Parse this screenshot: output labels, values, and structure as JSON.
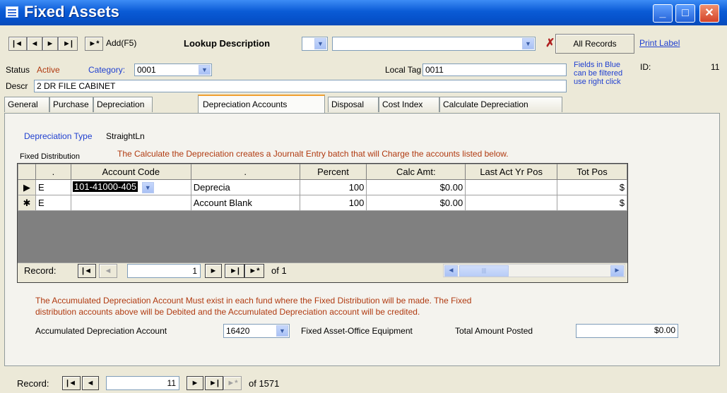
{
  "window": {
    "title": "Fixed Assets",
    "minimize": "_",
    "maximize": "□",
    "close": "✕"
  },
  "toolbar": {
    "first": "|◄",
    "prev": "◄",
    "next": "►",
    "last": "►|",
    "new_rec": "►*",
    "add_label": "Add(F5)",
    "lookup_label": "Lookup Description",
    "lookup_value": "",
    "clear_filter": "✗",
    "all_records": "All Records",
    "print_label": "Print Label"
  },
  "header": {
    "status_label": "Status",
    "status_value": "Active",
    "category_label": "Category:",
    "category_value": "0001",
    "local_tag_label": "Local Tag",
    "local_tag_value": "0011",
    "note": [
      "Fields in Blue",
      "can be filtered",
      "use right click"
    ],
    "id_label": "ID:",
    "id_value": "11",
    "descr_label": "Descr",
    "descr_value": "2 DR FILE CABINET"
  },
  "tabs": [
    "General",
    "Purchase",
    "Depreciation",
    "Depreciation Accounts",
    "Disposal",
    "Cost Index",
    "Calculate Depreciation"
  ],
  "content": {
    "dep_type_label": "Depreciation Type",
    "dep_type_value": "StraightLn",
    "fixed_dist_label": "Fixed Distribution",
    "calc_note": "The Calculate the Depreciation creates a Journalt Entry batch that will Charge the accounts listed below."
  },
  "grid": {
    "columns": [
      ".",
      "Account Code",
      ".",
      "Percent",
      "Calc Amt:",
      "Last Act Yr Pos",
      "Tot Pos"
    ],
    "rows": [
      {
        "marker": "▶",
        "type": "E",
        "account_code": "101-41000-405",
        "desc": "Deprecia",
        "percent": "100",
        "calc_amt": "$0.00",
        "last_yr": "",
        "tot": "$"
      },
      {
        "marker": "✱",
        "type": "E",
        "account_code": "",
        "desc": "Account Blank",
        "percent": "100",
        "calc_amt": "$0.00",
        "last_yr": "",
        "tot": "$"
      }
    ],
    "nav": {
      "label": "Record:",
      "current": "1",
      "of": "of 1"
    }
  },
  "accum": {
    "note_line1": "The Accumulated Depreciation Account Must exist in each fund where the Fixed Distribution will be made.   The Fixed",
    "note_line2": "distribution accounts above will be Debited and the Accumulated Depreciation account will be credited.",
    "label": "Accumulated Depreciation Account",
    "value": "16420",
    "desc": "Fixed Asset-Office Equipment",
    "total_label": "Total Amount Posted",
    "total_value": "$0.00"
  },
  "footer": {
    "label": "Record:",
    "current": "11",
    "of": "of  1571"
  }
}
